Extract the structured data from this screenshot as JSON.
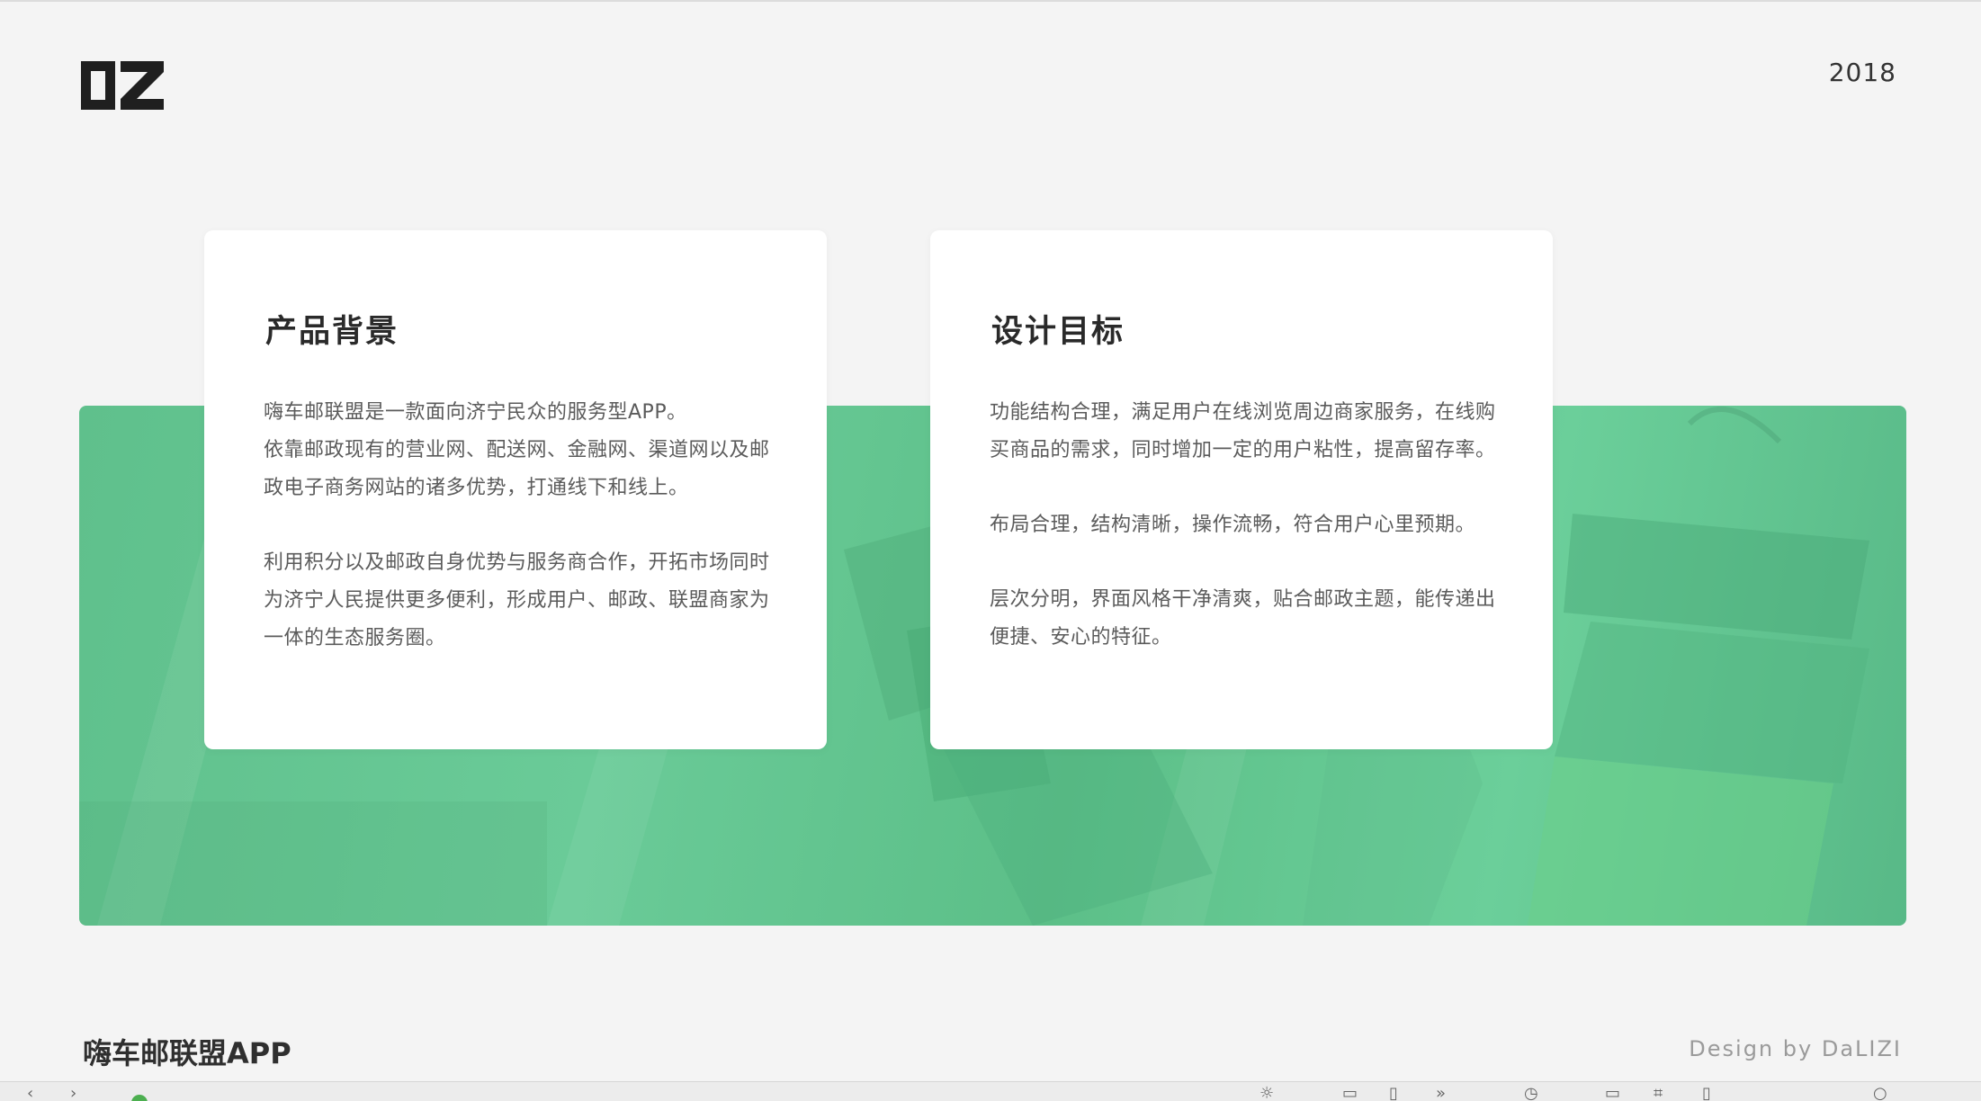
{
  "header": {
    "logo_text": "DZ",
    "year": "2018"
  },
  "cards": [
    {
      "title": "产品背景",
      "paragraphs": [
        [
          "嗨车邮联盟是一款面向济宁民众的服务型APP。",
          "依靠邮政现有的营业网、配送网、金融网、渠道网以及邮",
          "政电子商务网站的诸多优势，打通线下和线上。"
        ],
        [
          "利用积分以及邮政自身优势与服务商合作，开拓市场同时",
          "为济宁人民提供更多便利，形成用户、邮政、联盟商家为",
          "一体的生态服务圈。"
        ]
      ]
    },
    {
      "title": "设计目标",
      "paragraphs": [
        [
          "功能结构合理，满足用户在线浏览周边商家服务，在线购",
          "买商品的需求，同时增加一定的用户粘性，提高留存率。"
        ],
        [
          "布局合理，结构清晰，操作流畅，符合用户心里预期。"
        ],
        [
          "层次分明，界面风格干净清爽，贴合邮政主题，能传递出",
          "便捷、安心的特征。"
        ]
      ]
    }
  ],
  "footer": {
    "title": "嗨车邮联盟APP",
    "credit": "Design by DaLIZI"
  },
  "colors": {
    "background": "#f4f4f4",
    "band_green": "#64c692",
    "card": "#ffffff",
    "title_text": "#2a2a2a",
    "body_text": "#5b5b5b",
    "credit_text": "#9a9a9a",
    "status_green": "#4caf50"
  },
  "toolbar": {
    "icons": [
      "chevron-left-icon",
      "chevron-right-icon",
      "status-icon",
      "sun-icon",
      "frame-icon",
      "document-icon",
      "forward-icon",
      "clock-icon",
      "window-icon",
      "crop-icon",
      "file-icon",
      "zoom-icon"
    ]
  }
}
